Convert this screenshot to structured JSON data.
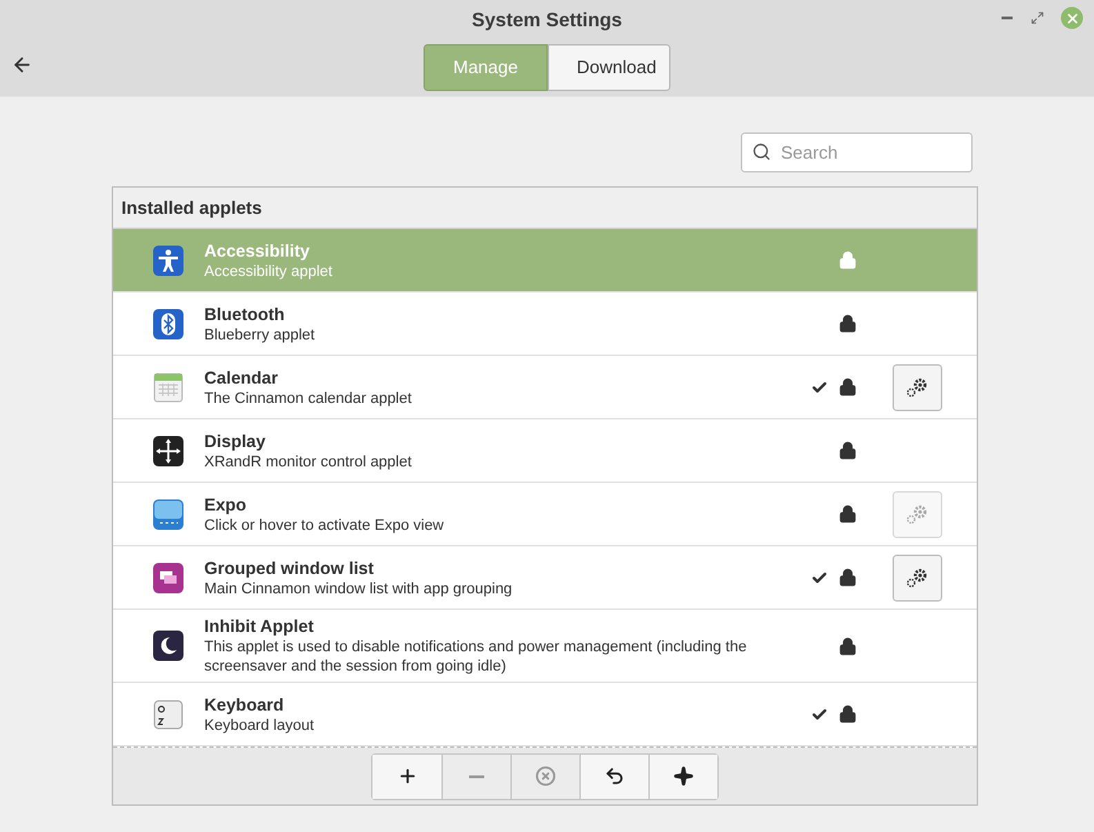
{
  "window": {
    "title": "System Settings"
  },
  "tabs": [
    {
      "label": "Manage",
      "selected": true
    },
    {
      "label": "Download",
      "selected": false
    }
  ],
  "search": {
    "placeholder": "Search"
  },
  "list": {
    "heading": "Installed applets",
    "applets": [
      {
        "name": "Accessibility",
        "description": "Accessibility applet",
        "selected": true,
        "enabled": false,
        "locked": true
      },
      {
        "name": "Bluetooth",
        "description": "Blueberry applet",
        "selected": false,
        "enabled": false,
        "locked": true
      },
      {
        "name": "Calendar",
        "description": "The Cinnamon calendar applet",
        "selected": false,
        "enabled": true,
        "locked": true,
        "settings_button": {
          "disabled": false
        }
      },
      {
        "name": "Display",
        "description": "XRandR monitor control applet",
        "selected": false,
        "enabled": false,
        "locked": true
      },
      {
        "name": "Expo",
        "description": "Click or hover to activate Expo view",
        "selected": false,
        "enabled": false,
        "locked": true,
        "settings_button": {
          "disabled": true
        }
      },
      {
        "name": "Grouped window list",
        "description": "Main Cinnamon window list with app grouping",
        "selected": false,
        "enabled": true,
        "locked": true,
        "settings_button": {
          "disabled": false
        }
      },
      {
        "name": "Inhibit Applet",
        "description": "This applet is used to disable notifications and power management (including the screensaver and the session from going idle)",
        "selected": false,
        "enabled": false,
        "locked": true
      },
      {
        "name": "Keyboard",
        "description": "Keyboard layout",
        "selected": false,
        "enabled": true,
        "locked": true
      }
    ]
  },
  "toolbar": [
    {
      "disabled": false
    },
    {
      "disabled": true
    },
    {
      "disabled": true
    },
    {
      "disabled": false
    },
    {
      "disabled": false
    }
  ]
}
